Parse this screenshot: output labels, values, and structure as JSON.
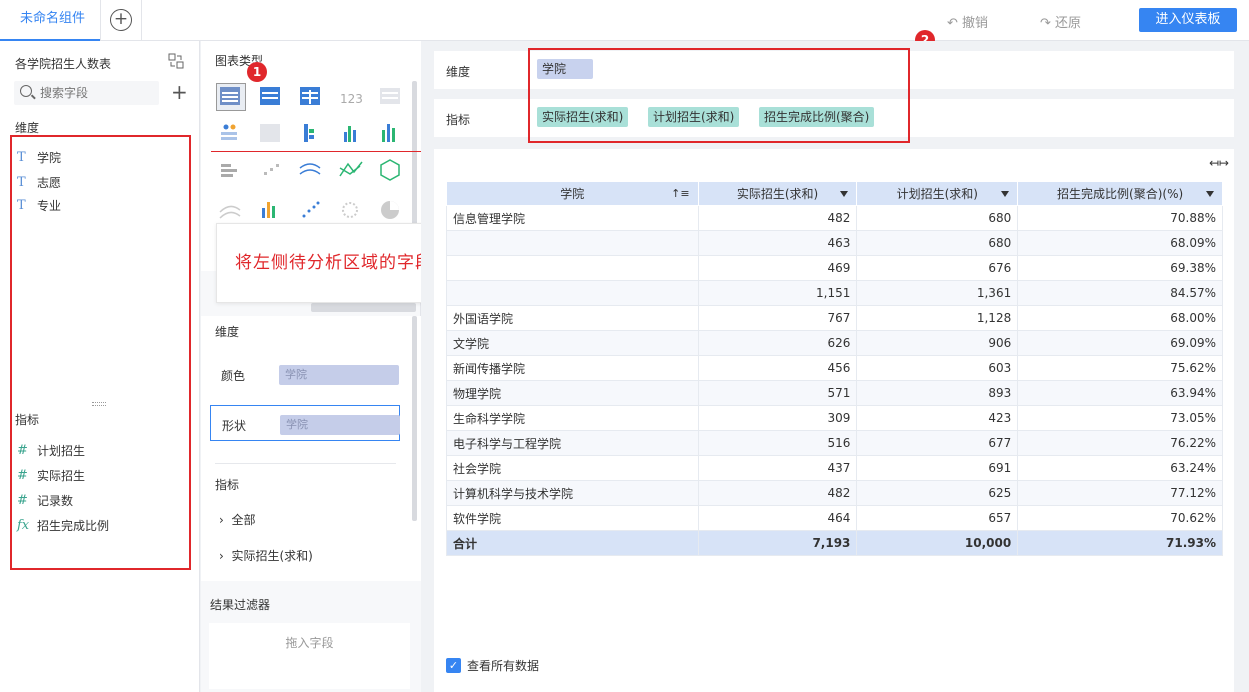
{
  "topbar": {
    "tab_label": "未命名组件",
    "add_tab": "+",
    "undo_label": "撤销",
    "redo_label": "还原",
    "enter_dashboard": "进入仪表板"
  },
  "left_panel": {
    "dataset_title": "各学院招生人数表",
    "search_placeholder": "搜索字段",
    "add_symbol": "+",
    "dimension_label": "维度",
    "dimensions": [
      {
        "icon": "T",
        "label": "学院"
      },
      {
        "icon": "T",
        "label": "志愿"
      },
      {
        "icon": "T",
        "label": "专业"
      }
    ],
    "measure_label": "指标",
    "measures": [
      {
        "icon": "#",
        "label": "计划招生"
      },
      {
        "icon": "#",
        "label": "实际招生"
      },
      {
        "icon": "#",
        "label": "记录数"
      },
      {
        "icon": "fx",
        "label": "招生完成比例"
      }
    ]
  },
  "middle_panel": {
    "chart_type_title": "图表类型",
    "dimension_label": "维度",
    "color_label": "颜色",
    "color_value": "学院",
    "shape_label": "形状",
    "shape_value": "学院",
    "measure_label": "指标",
    "tree_all": "全部",
    "tree_actual": "实际招生(求和)",
    "result_filter_label": "结果过滤器",
    "drop_field": "拖入字段"
  },
  "annotation": {
    "note": "将左侧待分析区域的字段拖入右侧维度指标栏",
    "badge1": "1",
    "badge2": "2"
  },
  "right_panel": {
    "dimension_zone_label": "维度",
    "dimension_chip": "学院",
    "measure_zone_label": "指标",
    "measure_chips": [
      "实际招生(求和)",
      "计划招生(求和)",
      "招生完成比例(聚合)"
    ],
    "columns": [
      "学院",
      "实际招生(求和)",
      "计划招生(求和)",
      "招生完成比例(聚合)(%)"
    ],
    "rows": [
      [
        "信息管理学院",
        "482",
        "680",
        "70.88%"
      ],
      [
        "",
        "463",
        "680",
        "68.09%"
      ],
      [
        "",
        "469",
        "676",
        "69.38%"
      ],
      [
        "",
        "1,151",
        "1,361",
        "84.57%"
      ],
      [
        "外国语学院",
        "767",
        "1,128",
        "68.00%"
      ],
      [
        "文学院",
        "626",
        "906",
        "69.09%"
      ],
      [
        "新闻传播学院",
        "456",
        "603",
        "75.62%"
      ],
      [
        "物理学院",
        "571",
        "893",
        "63.94%"
      ],
      [
        "生命科学学院",
        "309",
        "423",
        "73.05%"
      ],
      [
        "电子科学与工程学院",
        "516",
        "677",
        "76.22%"
      ],
      [
        "社会学院",
        "437",
        "691",
        "63.24%"
      ],
      [
        "计算机科学与技术学院",
        "482",
        "625",
        "77.12%"
      ],
      [
        "软件学院",
        "464",
        "657",
        "70.62%"
      ]
    ],
    "total": [
      "合计",
      "7,193",
      "10,000",
      "71.93%"
    ],
    "view_all_label": "查看所有数据",
    "check_mark": "✓"
  },
  "colors": {
    "accent": "#3685f2",
    "annotation_red": "#e0272b",
    "dim_chip": "#c8d2ee",
    "measure_chip": "#a9e0d8",
    "header_bg": "#d7e3f7"
  }
}
